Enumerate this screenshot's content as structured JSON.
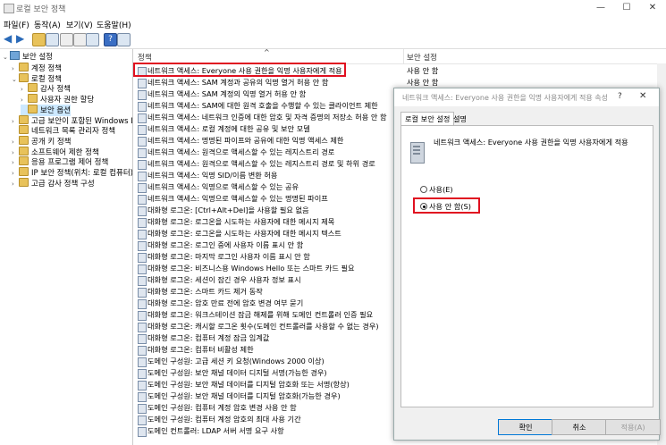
{
  "window": {
    "title": "로컬 보안 정책",
    "controls": [
      "—",
      "☐",
      "✕"
    ]
  },
  "menu": {
    "items": [
      "파일(F)",
      "동작(A)",
      "보기(V)",
      "도움말(H)"
    ]
  },
  "tree": {
    "root": "보안 설정",
    "nodes": [
      {
        "label": "계정 정책",
        "level": 1,
        "expander": "›"
      },
      {
        "label": "로컬 정책",
        "level": 1,
        "expander": "⌄"
      },
      {
        "label": "감사 정책",
        "level": 2,
        "expander": "›"
      },
      {
        "label": "사용자 권한 할당",
        "level": 2,
        "expander": "›"
      },
      {
        "label": "보안 옵션",
        "level": 2,
        "expander": "",
        "selected": true
      },
      {
        "label": "고급 보안이 포함된 Windows Defende",
        "level": 1,
        "expander": "›"
      },
      {
        "label": "네트워크 목록 관리자 정책",
        "level": 1,
        "expander": ""
      },
      {
        "label": "공개 키 정책",
        "level": 1,
        "expander": "›"
      },
      {
        "label": "소프트웨어 제한 정책",
        "level": 1,
        "expander": "›"
      },
      {
        "label": "응용 프로그램 제어 정책",
        "level": 1,
        "expander": "›"
      },
      {
        "label": "IP 보안 정책(위치: 로컬 컴퓨터)",
        "level": 1,
        "expander": "›"
      },
      {
        "label": "고급 감사 정책 구성",
        "level": 1,
        "expander": "›"
      }
    ]
  },
  "list": {
    "columns": [
      "정책",
      "보안 설정"
    ],
    "rows": [
      {
        "policy": "네트워크 액세스: Everyone 사용 권한을 익명 사용자에게 적용",
        "setting": "사용 안 함"
      },
      {
        "policy": "네트워크 액세스: SAM 계정과 공유의 익명 열거 허용 안 함",
        "setting": "사용 안 함"
      },
      {
        "policy": "네트워크 액세스: SAM 계정의 익명 열거 허용 안 함",
        "setting": "사용"
      },
      {
        "policy": "네트워크 액세스: SAM에 대한 원격 호출을 수행할 수 있는 클라이언트 제한",
        "setting": ""
      },
      {
        "policy": "네트워크 액세스: 네트워크 인증에 대한 암호 및 자격 증명의 저장소 허용 안 함",
        "setting": ""
      },
      {
        "policy": "네트워크 액세스: 로컬 계정에 대한 공유 및 보안 모델",
        "setting": ""
      },
      {
        "policy": "네트워크 액세스: 명명된 파이프와 공유에 대한 익명 액세스 제한",
        "setting": ""
      },
      {
        "policy": "네트워크 액세스: 원격으로 액세스할 수 있는 레지스트리 경로",
        "setting": ""
      },
      {
        "policy": "네트워크 액세스: 원격으로 액세스할 수 있는 레지스트리 경로 및 하위 경로",
        "setting": ""
      },
      {
        "policy": "네트워크 액세스: 익명 SID/이름 변환 허용",
        "setting": ""
      },
      {
        "policy": "네트워크 액세스: 익명으로 액세스할 수 있는 공유",
        "setting": ""
      },
      {
        "policy": "네트워크 액세스: 익명으로 액세스할 수 있는 명명된 파이프",
        "setting": ""
      },
      {
        "policy": "대화형 로그온: [Ctrl+Alt+Del]을 사용할 필요 없음",
        "setting": ""
      },
      {
        "policy": "대화형 로그온: 로그온을 시도하는 사용자에 대한 메시지 제목",
        "setting": ""
      },
      {
        "policy": "대화형 로그온: 로그온을 시도하는 사용자에 대한 메시지 텍스트",
        "setting": ""
      },
      {
        "policy": "대화형 로그온: 로그인 중에 사용자 이름 표시 안 함",
        "setting": ""
      },
      {
        "policy": "대화형 로그온: 마지막 로그인 사용자 이름 표시 안 함",
        "setting": ""
      },
      {
        "policy": "대화형 로그온: 비즈니스용 Windows Hello 또는 스마트 카드 필요",
        "setting": ""
      },
      {
        "policy": "대화형 로그온: 세션이 잠긴 경우 사용자 정보 표시",
        "setting": ""
      },
      {
        "policy": "대화형 로그온: 스마트 카드 제거 동작",
        "setting": ""
      },
      {
        "policy": "대화형 로그온: 암호 만료 전에 암호 변경 여부 묻기",
        "setting": ""
      },
      {
        "policy": "대화형 로그온: 워크스테이션 잠금 해제를 위해 도메인 컨트롤러 인증 필요",
        "setting": ""
      },
      {
        "policy": "대화형 로그온: 캐시할 로그온 횟수(도메인 컨트롤러를 사용할 수 없는 경우)",
        "setting": ""
      },
      {
        "policy": "대화형 로그온: 컴퓨터 계정 잠금 임계값",
        "setting": ""
      },
      {
        "policy": "대화형 로그온: 컴퓨터 비활성 제한",
        "setting": ""
      },
      {
        "policy": "도메인 구성원: 고급 세션 키 요청(Windows 2000 이상)",
        "setting": ""
      },
      {
        "policy": "도메인 구성원: 보안 채널 데이터 디지털 서명(가능한 경우)",
        "setting": ""
      },
      {
        "policy": "도메인 구성원: 보안 채널 데이터를 디지털 암호화 또는 서명(항상)",
        "setting": ""
      },
      {
        "policy": "도메인 구성원: 보안 채널 데이터를 디지털 암호화(가능한 경우)",
        "setting": ""
      },
      {
        "policy": "도메인 구성원: 컴퓨터 계정 암호 변경 사용 안 함",
        "setting": ""
      },
      {
        "policy": "도메인 구성원: 컴퓨터 계정 암호의 최대 사용 기간",
        "setting": ""
      },
      {
        "policy": "도메인 컨트롤러: LDAP 서버 서명 요구 사항",
        "setting": ""
      }
    ]
  },
  "dialog": {
    "title": "네트워크 액세스: Everyone 사용 권한을 익명 사용자에게 적용 속성",
    "help": "?",
    "close": "✕",
    "tabs": [
      "로컬 보안 설정",
      "설명"
    ],
    "policy_name": "네트워크 액세스: Everyone 사용 권한을 익명 사용자에게 적용",
    "options": [
      {
        "label": "사용(E)",
        "checked": false
      },
      {
        "label": "사용 안 함(S)",
        "checked": true
      }
    ],
    "buttons": {
      "ok": "확인",
      "cancel": "취소",
      "apply": "적용(A)"
    }
  },
  "colors": {
    "highlight_border": "#e01020",
    "selection": "#cce8ff"
  }
}
